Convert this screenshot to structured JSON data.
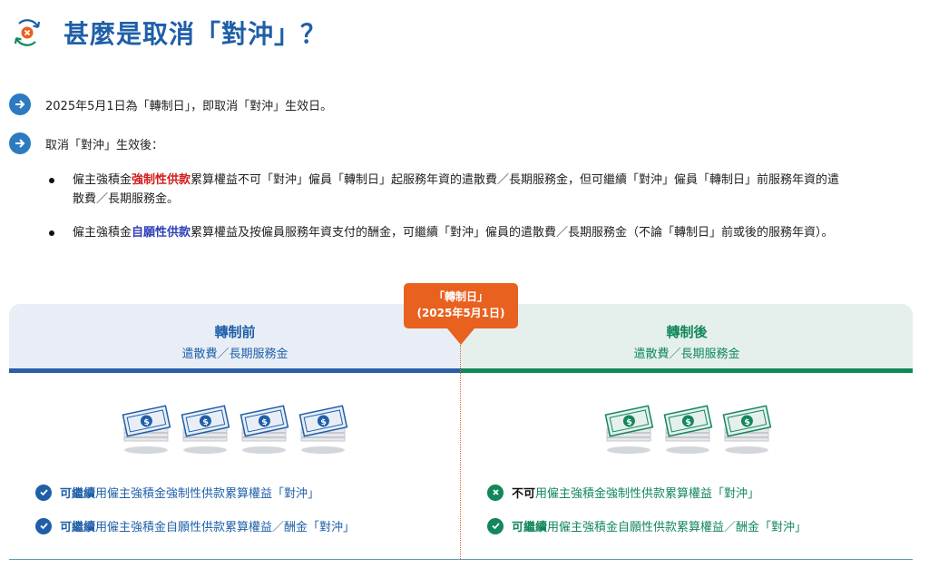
{
  "header": {
    "title": "甚麼是取消「對沖」？",
    "icon": "cancel-offset-icon"
  },
  "points": [
    {
      "text": "2025年5月1日為「轉制日」，即取消「對沖」生效日。"
    },
    {
      "text": "取消「對沖」生效後："
    }
  ],
  "bullets": [
    {
      "pre": "僱主強積金",
      "highlight": "強制性供款",
      "post": "累算權益不可「對沖」僱員「轉制日」起服務年資的遣散費／長期服務金，但可繼續「對沖」僱員「轉制日」前服務年資的遣",
      "line2": "散費／長期服務金。"
    },
    {
      "pre": "僱主強積金",
      "highlight": "自願性供款",
      "post": "累算權益及按僱員服務年資支付的酬金，可繼續「對沖」僱員的遣散費／長期服務金（不論「轉制日」前或後的服務年資）。"
    }
  ],
  "callout": {
    "line1": "「轉制日」",
    "line2": "(2025年5月1日)"
  },
  "before": {
    "title": "轉制前",
    "subtitle": "遣散費／長期服務金",
    "items": [
      {
        "bold": "可繼續",
        "text": "用僱主強積金強制性供款累算權益「對沖」",
        "status": "check"
      },
      {
        "bold": "可繼續",
        "text": "用僱主強積金自願性供款累算權益／酬金「對沖」",
        "status": "check"
      }
    ]
  },
  "after": {
    "title": "轉制後",
    "subtitle": "遣散費／長期服務金",
    "items": [
      {
        "bold": "不可",
        "text": "用僱主強積金強制性供款累算權益「對沖」",
        "status": "cross"
      },
      {
        "bold": "可繼續",
        "text": "用僱主強積金自願性供款累算權益／酬金「對沖」",
        "status": "check"
      }
    ]
  },
  "colors": {
    "blue": "#1f5fa8",
    "green": "#12875a",
    "orange": "#e8611f",
    "red": "#d21d1d"
  }
}
